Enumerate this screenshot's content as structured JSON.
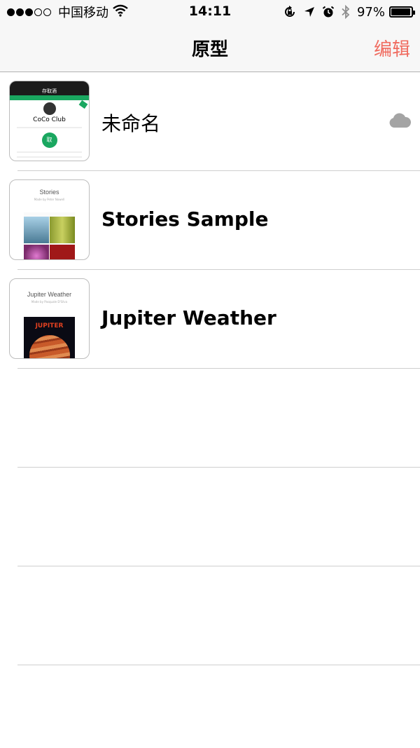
{
  "status_bar": {
    "signal_dots": [
      true,
      true,
      true,
      false,
      false
    ],
    "carrier": "中国移动",
    "time": "14:11",
    "battery_percent": "97%",
    "battery_level": 0.97,
    "icons": [
      "wifi-icon",
      "orientation-lock-icon",
      "location-arrow-icon",
      "alarm-icon",
      "bluetooth-icon",
      "battery-icon"
    ]
  },
  "navbar": {
    "title": "原型",
    "edit_label": "编辑"
  },
  "colors": {
    "accent": "#f06b5f",
    "bar_bg": "#f7f7f7",
    "separator": "#cfcfcf",
    "cloud": "#a4a4a4"
  },
  "prototypes": [
    {
      "title": "未命名",
      "cloud_icon": "cloud-icon",
      "thumb": {
        "header": "存取酒",
        "name": "CoCo Club",
        "button": "取"
      }
    },
    {
      "title": "Stories Sample",
      "thumb": {
        "title": "Stories",
        "subtitle": "Made by Peter Nowell"
      }
    },
    {
      "title": "Jupiter Weather",
      "thumb": {
        "title": "Jupiter Weather",
        "subtitle": "Made by Pasquale D'Silva",
        "word": "JUPITER"
      }
    }
  ]
}
